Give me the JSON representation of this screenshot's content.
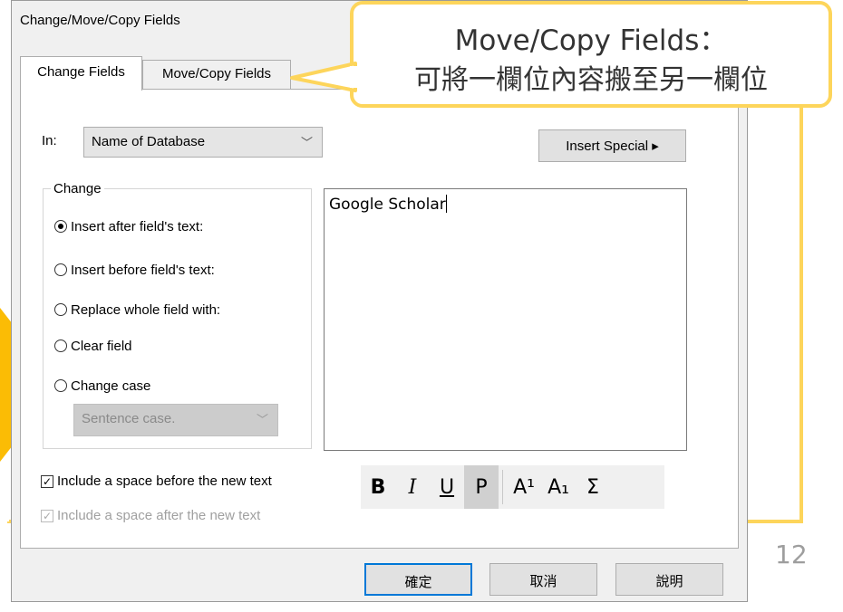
{
  "window": {
    "title": "Change/Move/Copy Fields"
  },
  "tabs": [
    {
      "label": "Change Fields",
      "active": true
    },
    {
      "label": "Move/Copy Fields",
      "active": false
    }
  ],
  "in_field": {
    "label": "In:",
    "value": "Name of Database"
  },
  "insert_special": {
    "label": "Insert Special ▸"
  },
  "change_group": {
    "title": "Change",
    "options": [
      {
        "label": "Insert after field's text:",
        "selected": true
      },
      {
        "label": "Insert before field's text:",
        "selected": false
      },
      {
        "label": "Replace whole field with:",
        "selected": false
      },
      {
        "label": "Clear field",
        "selected": false
      },
      {
        "label": "Change case",
        "selected": false
      }
    ],
    "case_select": {
      "value": "Sentence case.",
      "enabled": false
    }
  },
  "text_input": {
    "value": "Google Scholar"
  },
  "checkboxes": [
    {
      "label": "Include a space before the new text",
      "checked": true,
      "enabled": true
    },
    {
      "label": "Include a space after the new text",
      "checked": true,
      "enabled": false
    }
  ],
  "format_buttons": {
    "bold": "B",
    "italic": "I",
    "underline": "U",
    "plain": "P",
    "superscript": "A¹",
    "subscript": "A₁",
    "symbol": "Σ"
  },
  "buttons": {
    "ok": "確定",
    "cancel": "取消",
    "help": "說明"
  },
  "annotation": {
    "title": "Move/Copy Fields：",
    "description": "可將一欄位內容搬至另一欄位",
    "color": "#fdd55b"
  },
  "slide": {
    "page_number": "12"
  }
}
